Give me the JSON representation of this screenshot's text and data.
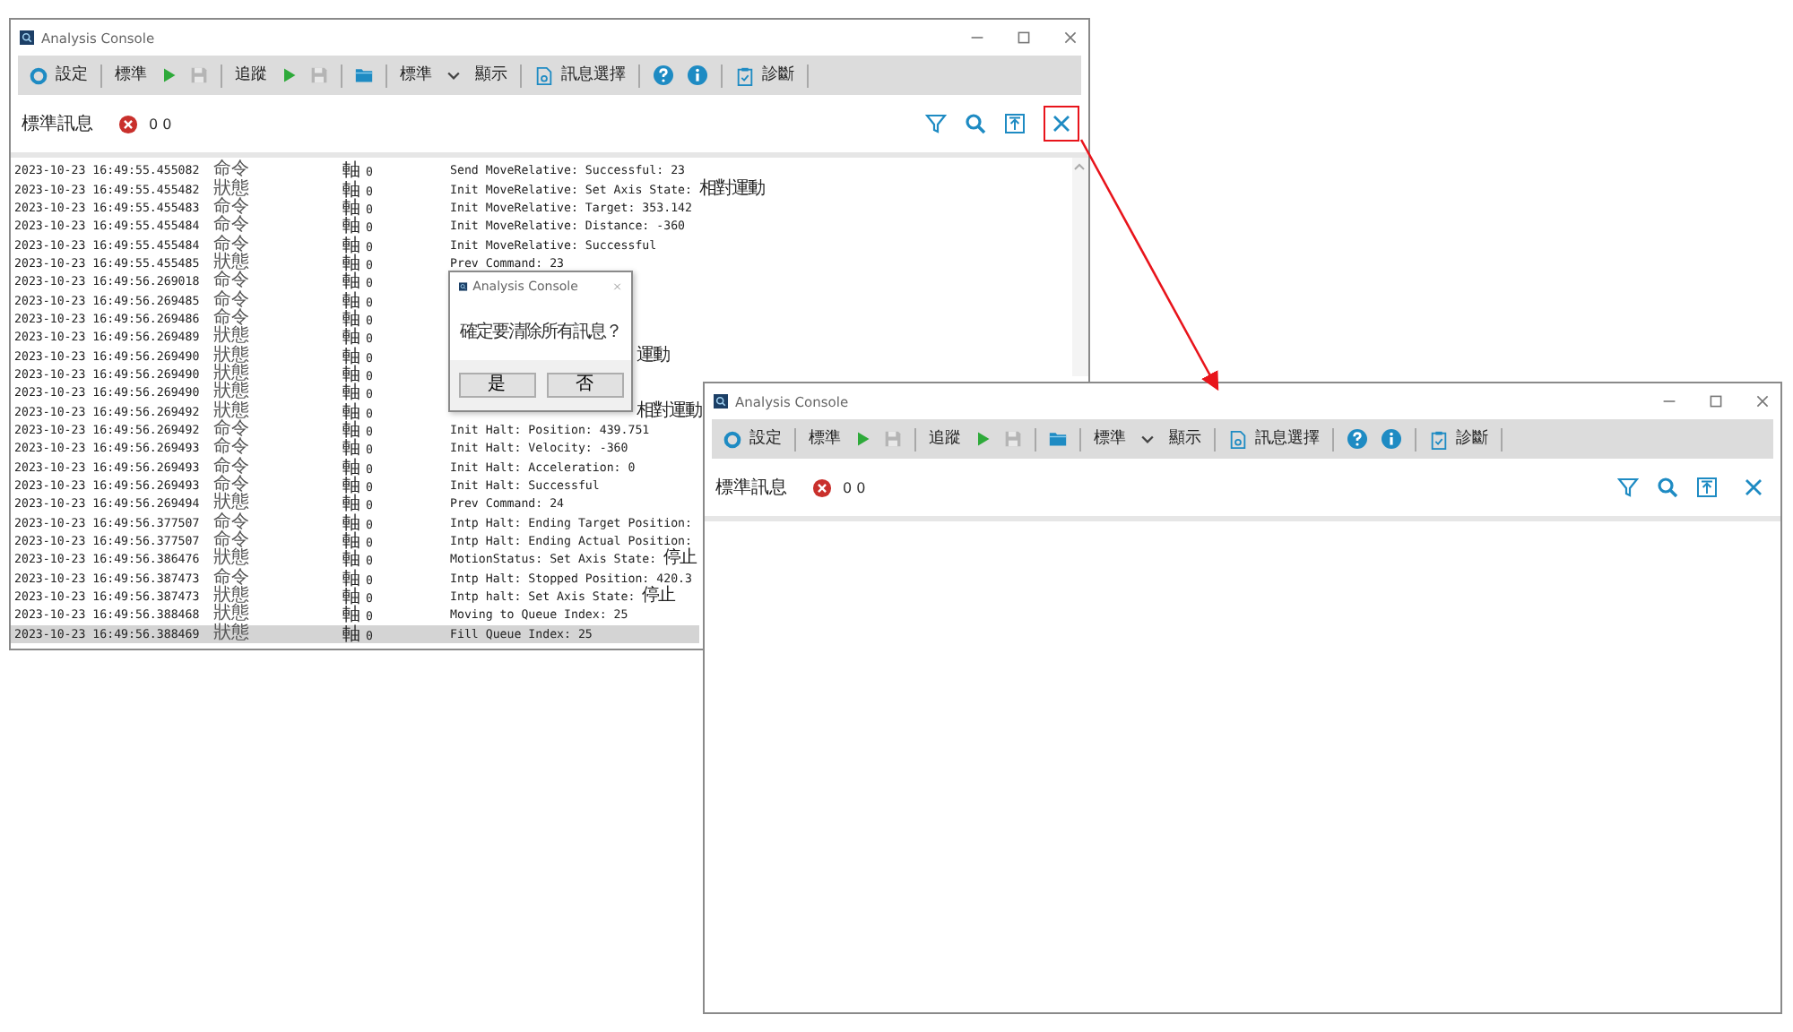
{
  "windows": [
    {
      "title": "Analysis Console",
      "clear_button_highlighted": true,
      "toolbar": [
        {
          "kind": "settings",
          "label": "設定"
        },
        {
          "kind": "separator"
        },
        {
          "kind": "text",
          "label": "標準"
        },
        {
          "kind": "play"
        },
        {
          "kind": "save"
        },
        {
          "kind": "separator"
        },
        {
          "kind": "text",
          "label": "追蹤"
        },
        {
          "kind": "play"
        },
        {
          "kind": "save"
        },
        {
          "kind": "separator"
        },
        {
          "kind": "folder"
        },
        {
          "kind": "separator"
        },
        {
          "kind": "text",
          "label": "標準"
        },
        {
          "kind": "dropdown"
        },
        {
          "kind": "text",
          "label": "顯示"
        },
        {
          "kind": "separator"
        },
        {
          "kind": "document",
          "label": "訊息選擇"
        },
        {
          "kind": "separator"
        },
        {
          "kind": "help"
        },
        {
          "kind": "info"
        },
        {
          "kind": "separator"
        },
        {
          "kind": "clipboard",
          "label": "診斷"
        },
        {
          "kind": "separator"
        }
      ],
      "panel_title": "標準訊息",
      "error_count": "0 0",
      "log": [
        {
          "time": "2023-10-23 16:49:55.455082",
          "type": "命令",
          "axis": "軸 0",
          "message": "Send MoveRelative: Successful: 23",
          "selected": false
        },
        {
          "time": "2023-10-23 16:49:55.455482",
          "type": "狀態",
          "axis": "軸 0",
          "message": "Init MoveRelative: Set Axis State: 相對運動",
          "selected": false
        },
        {
          "time": "2023-10-23 16:49:55.455483",
          "type": "命令",
          "axis": "軸 0",
          "message": "Init MoveRelative: Target: 353.142",
          "selected": false
        },
        {
          "time": "2023-10-23 16:49:55.455484",
          "type": "命令",
          "axis": "軸 0",
          "message": "Init MoveRelative: Distance: -360",
          "selected": false
        },
        {
          "time": "2023-10-23 16:49:55.455484",
          "type": "命令",
          "axis": "軸 0",
          "message": "Init MoveRelative: Successful",
          "selected": false
        },
        {
          "time": "2023-10-23 16:49:55.455485",
          "type": "狀態",
          "axis": "軸 0",
          "message": "Prev Command: 23",
          "selected": false
        },
        {
          "time": "2023-10-23 16:49:56.269018",
          "type": "命令",
          "axis": "軸 0",
          "selected": false
        },
        {
          "time": "2023-10-23 16:49:56.269485",
          "type": "命令",
          "axis": "軸 0",
          "selected": false
        },
        {
          "time": "2023-10-23 16:49:56.269486",
          "type": "命令",
          "axis": "軸 0",
          "selected": false
        },
        {
          "time": "2023-10-23 16:49:56.269489",
          "type": "狀態",
          "axis": "軸 0",
          "selected": false
        },
        {
          "time": "2023-10-23 16:49:56.269490",
          "type": "狀態",
          "axis": "軸 0",
          "message": "運動",
          "kind": "behind_dialog",
          "selected": false
        },
        {
          "time": "2023-10-23 16:49:56.269490",
          "type": "狀態",
          "axis": "軸 0",
          "selected": false
        },
        {
          "time": "2023-10-23 16:49:56.269490",
          "type": "狀態",
          "axis": "軸 0",
          "selected": false
        },
        {
          "time": "2023-10-23 16:49:56.269492",
          "type": "狀態",
          "axis": "軸 0",
          "message": "相對運動",
          "kind": "behind_dialog",
          "selected": false
        },
        {
          "time": "2023-10-23 16:49:56.269492",
          "type": "命令",
          "axis": "軸 0",
          "message": "Init Halt: Position: 439.751",
          "selected": false
        },
        {
          "time": "2023-10-23 16:49:56.269493",
          "type": "命令",
          "axis": "軸 0",
          "message": "Init Halt: Velocity: -360",
          "selected": false
        },
        {
          "time": "2023-10-23 16:49:56.269493",
          "type": "命令",
          "axis": "軸 0",
          "message": "Init Halt: Acceleration: 0",
          "selected": false
        },
        {
          "time": "2023-10-23 16:49:56.269493",
          "type": "命令",
          "axis": "軸 0",
          "message": "Init Halt: Successful",
          "selected": false
        },
        {
          "time": "2023-10-23 16:49:56.269494",
          "type": "狀態",
          "axis": "軸 0",
          "message": "Prev Command: 24",
          "selected": false
        },
        {
          "time": "2023-10-23 16:49:56.377507",
          "type": "命令",
          "axis": "軸 0",
          "message": "Intp Halt: Ending Target Position:",
          "selected": false
        },
        {
          "time": "2023-10-23 16:49:56.377507",
          "type": "命令",
          "axis": "軸 0",
          "message": "Intp Halt: Ending Actual Position:",
          "selected": false
        },
        {
          "time": "2023-10-23 16:49:56.386476",
          "type": "狀態",
          "axis": "軸 0",
          "message": "MotionStatus: Set Axis State: 停止",
          "selected": false
        },
        {
          "time": "2023-10-23 16:49:56.387473",
          "type": "命令",
          "axis": "軸 0",
          "message": "Intp Halt: Stopped Position: 420.3",
          "selected": false
        },
        {
          "time": "2023-10-23 16:49:56.387473",
          "type": "狀態",
          "axis": "軸 0",
          "message": "Intp halt: Set Axis State: 停止",
          "selected": false
        },
        {
          "time": "2023-10-23 16:49:56.388468",
          "type": "狀態",
          "axis": "軸 0",
          "message": "Moving to Queue Index: 25",
          "selected": false
        },
        {
          "time": "2023-10-23 16:49:56.388469",
          "type": "狀態",
          "axis": "軸 0",
          "message": "Fill Queue Index: 25",
          "selected": true
        }
      ]
    },
    {
      "title": "Analysis Console",
      "clear_button_highlighted": false,
      "toolbar": [
        {
          "kind": "settings",
          "label": "設定"
        },
        {
          "kind": "separator"
        },
        {
          "kind": "text",
          "label": "標準"
        },
        {
          "kind": "play"
        },
        {
          "kind": "save"
        },
        {
          "kind": "separator"
        },
        {
          "kind": "text",
          "label": "追蹤"
        },
        {
          "kind": "play"
        },
        {
          "kind": "save"
        },
        {
          "kind": "separator"
        },
        {
          "kind": "folder"
        },
        {
          "kind": "separator"
        },
        {
          "kind": "text",
          "label": "標準"
        },
        {
          "kind": "dropdown"
        },
        {
          "kind": "text",
          "label": "顯示"
        },
        {
          "kind": "separator"
        },
        {
          "kind": "document",
          "label": "訊息選擇"
        },
        {
          "kind": "separator"
        },
        {
          "kind": "help"
        },
        {
          "kind": "info"
        },
        {
          "kind": "separator"
        },
        {
          "kind": "clipboard",
          "label": "診斷"
        },
        {
          "kind": "separator"
        }
      ],
      "panel_title": "標準訊息",
      "error_count": "0 0"
    }
  ],
  "dialog": {
    "title": "Analysis Console",
    "message": "確定要清除所有訊息？",
    "buttons": [
      "是",
      "否"
    ]
  }
}
